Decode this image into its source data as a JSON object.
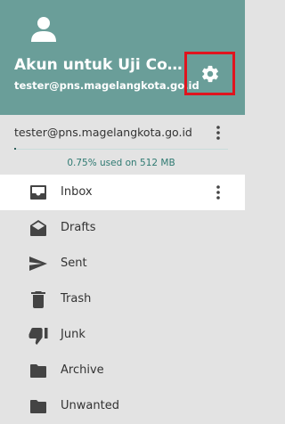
{
  "account": {
    "name": "Akun untuk Uji Cob...",
    "email": "tester@pns.magelangkota.go.id"
  },
  "quota": {
    "email": "tester@pns.magelangkota.go.id",
    "used_text": "0.75% used on 512 MB",
    "used_fraction": 0.0075
  },
  "folders": [
    {
      "label": "Inbox",
      "icon": "inbox-icon",
      "selected": true
    },
    {
      "label": "Drafts",
      "icon": "drafts-icon",
      "selected": false
    },
    {
      "label": "Sent",
      "icon": "send-icon",
      "selected": false
    },
    {
      "label": "Trash",
      "icon": "trash-icon",
      "selected": false
    },
    {
      "label": "Junk",
      "icon": "thumbs-down-icon",
      "selected": false
    },
    {
      "label": "Archive",
      "icon": "archive-folder-icon",
      "selected": false
    },
    {
      "label": "Unwanted",
      "icon": "folder-icon",
      "selected": false
    }
  ],
  "colors": {
    "header": "#6a9e99",
    "highlight": "#e0141e",
    "quota_text": "#2f7a72",
    "sidebar": "#e3e3e3"
  }
}
